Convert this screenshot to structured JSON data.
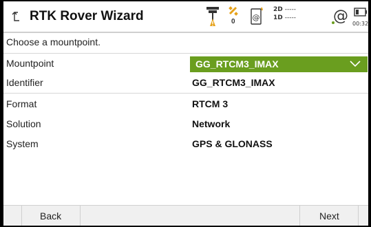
{
  "header": {
    "title": "RTK Rover Wizard",
    "icons": {
      "back": "return-arrow-icon",
      "rover": "rover-antenna-icon",
      "satellite": "satellite-icon",
      "radio": "radio-at-icon",
      "internet": "internet-at-icon",
      "battery": "battery-icon"
    },
    "satellite_count": "0",
    "position_2d_label": "2D",
    "position_2d_value": "-----",
    "position_1d_label": "1D",
    "position_1d_value": "-----",
    "battery_time": "00:32",
    "accent_color": "#6a9e1f",
    "warning_color": "#e6a21a"
  },
  "instruction": "Choose a mountpoint.",
  "fields": {
    "mountpoint": {
      "label": "Mountpoint",
      "value": "GG_RTCM3_IMAX"
    },
    "identifier": {
      "label": "Identifier",
      "value": "GG_RTCM3_IMAX"
    },
    "format": {
      "label": "Format",
      "value": "RTCM 3"
    },
    "solution": {
      "label": "Solution",
      "value": "Network"
    },
    "system": {
      "label": "System",
      "value": "GPS & GLONASS"
    }
  },
  "footer": {
    "back_label": "Back",
    "next_label": "Next"
  }
}
